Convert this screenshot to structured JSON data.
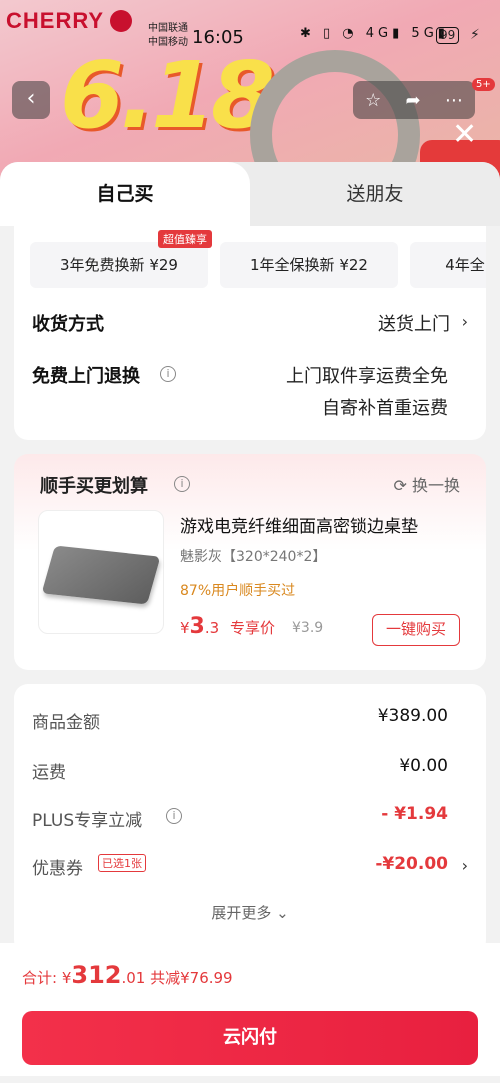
{
  "status_bar": {
    "brand": "CHERRY",
    "carrier1": "中国联通",
    "carrier2": "中国移动",
    "time": "16:05",
    "icons": "✱ ▯ ◔ 4G▮ 5G▮",
    "battery": "99"
  },
  "hero": {
    "text": "6.18"
  },
  "nav": {
    "badge": "5+"
  },
  "tabs": {
    "self": "自己买",
    "gift": "送朋友"
  },
  "services": [
    {
      "label": "3年免费换新 ¥29"
    },
    {
      "label": "1年全保换新 ¥22"
    },
    {
      "label": "4年全"
    }
  ],
  "services_badge": "超值臻享",
  "delivery": {
    "label": "收货方式",
    "value": "送货上门"
  },
  "return": {
    "label": "免费上门退换",
    "value1": "上门取件享运费全免",
    "value2": "自寄补首重运费"
  },
  "addon": {
    "title": "顺手买更划算",
    "swap": "换一换",
    "name": "游戏电竞纤维细面高密锁边桌垫",
    "spec": "魅影灰【320*240*2】",
    "stat": "87%用户顺手买过",
    "price_symbol": "¥",
    "price_int": "3",
    "price_dec": ".3",
    "price_tag": "专享价",
    "orig_price": "¥3.9",
    "buy": "一键购买"
  },
  "fees": {
    "goods_label": "商品金额",
    "goods_value": "¥389.00",
    "ship_label": "运费",
    "ship_value": "¥0.00",
    "plus_label": "PLUS专享立减",
    "plus_value": "- ¥1.94",
    "coupon_label": "优惠券",
    "coupon_tag": "已选1张",
    "coupon_value": "-¥20.00",
    "expand": "展开更多"
  },
  "footer": {
    "total_label": "合计: ",
    "total_symbol": "¥",
    "total_int": "312",
    "total_dec": ".01",
    "saved": " 共减¥76.99",
    "pay": "云闪付"
  }
}
